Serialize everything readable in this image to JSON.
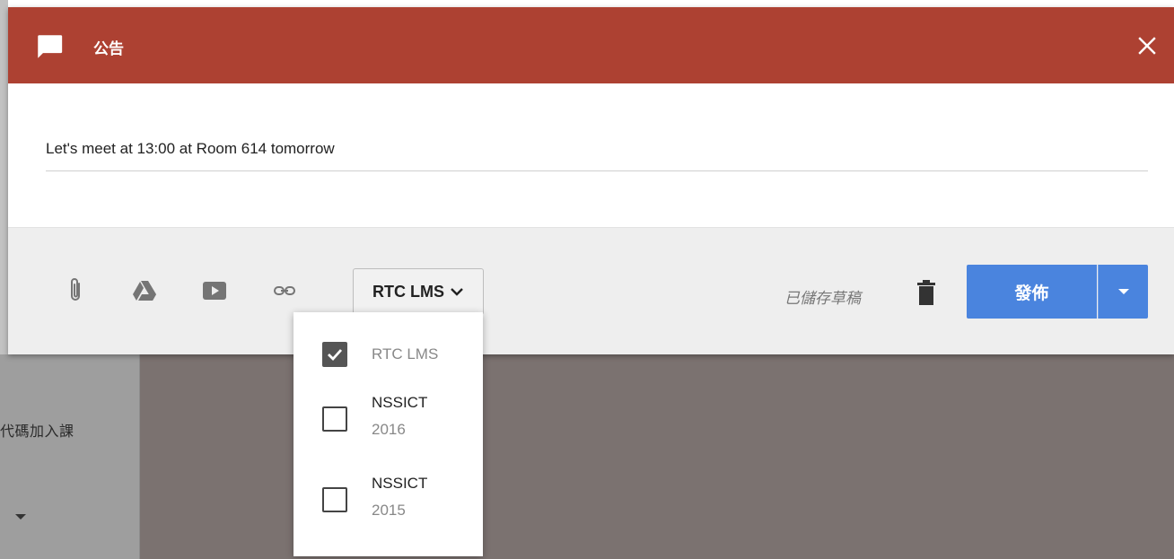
{
  "dialog": {
    "title": "公告",
    "post_text": "Let's meet at 13:00 at Room 614 tomorrow"
  },
  "toolbar": {
    "icons": [
      "attachment-icon",
      "google-drive-icon",
      "youtube-icon",
      "link-icon"
    ],
    "class_selector_label": "RTC LMS",
    "draft_status": "已儲存草稿",
    "publish_label": "發佈"
  },
  "class_menu": {
    "items": [
      {
        "line1": "RTC LMS",
        "line2": "",
        "checked": true
      },
      {
        "line1": "NSSICT",
        "line2": "2016",
        "checked": false
      },
      {
        "line1": "NSSICT",
        "line2": "2015",
        "checked": false
      }
    ]
  },
  "background": {
    "join_text": "代碼加入課"
  },
  "colors": {
    "header": "#ad4132",
    "publish": "#4a84de",
    "toolbar": "#eeeeee"
  }
}
